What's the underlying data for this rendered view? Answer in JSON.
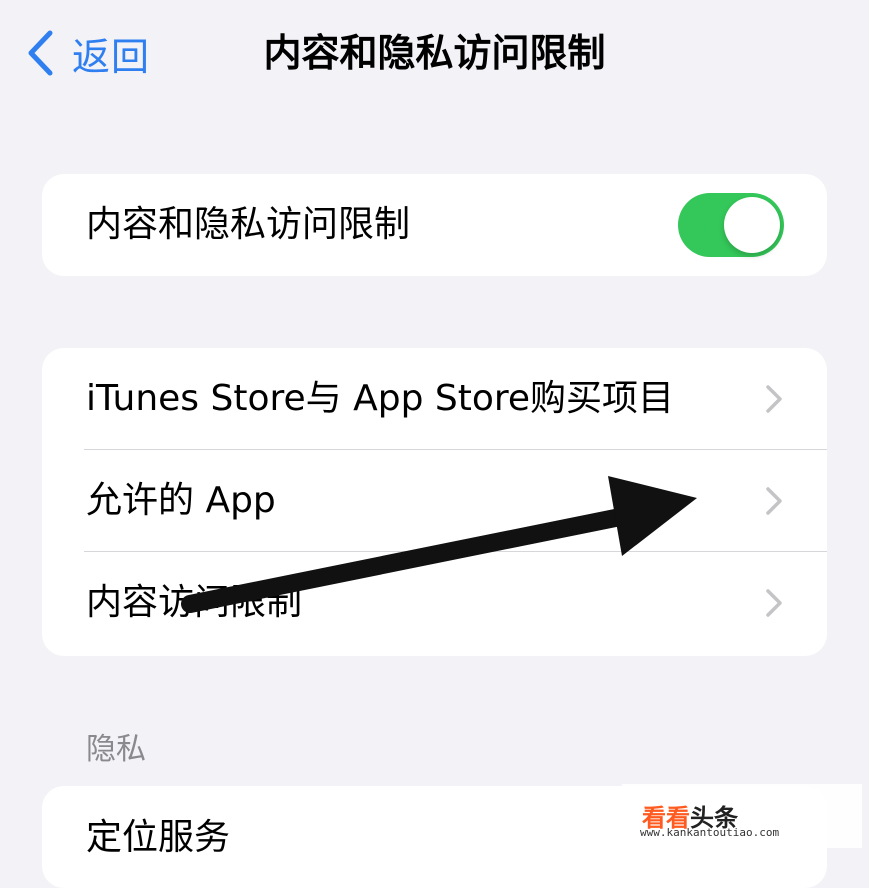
{
  "nav": {
    "back_label": "返回",
    "title": "内容和隐私访问限制"
  },
  "main_toggle": {
    "label": "内容和隐私访问限制",
    "state": "on",
    "on_color": "#34c759"
  },
  "store_group": {
    "items": [
      {
        "label": "iTunes Store与 App Store购买项目"
      },
      {
        "label": "允许的 App"
      },
      {
        "label": "内容访问限制"
      }
    ]
  },
  "privacy_section": {
    "header": "隐私",
    "items": [
      {
        "label": "定位服务"
      }
    ]
  },
  "watermark": {
    "brand_part1": "看看",
    "brand_part2": "头条",
    "url": "www.kankantoutiao.com"
  },
  "colors": {
    "accent": "#2f7ff0",
    "background": "#f2f2f7",
    "secondary_text": "#8a8a8e"
  }
}
